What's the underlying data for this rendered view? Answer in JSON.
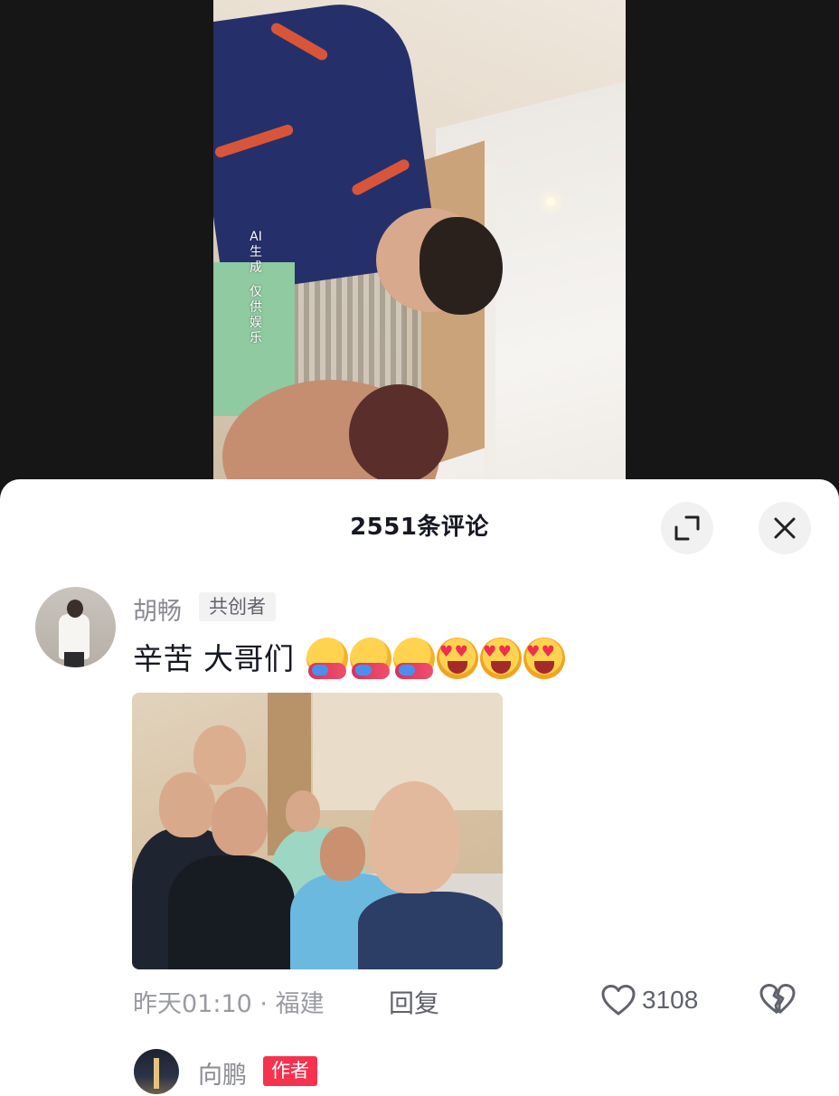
{
  "video": {
    "ai_label_lines": [
      "AI",
      "生成",
      "",
      "仅供",
      "娱乐"
    ]
  },
  "comments_panel": {
    "title": "2551条评论",
    "expand_icon": "expand-icon",
    "close_icon": "close-icon"
  },
  "comments": [
    {
      "username": "胡畅",
      "tag": "共创者",
      "text": "辛苦 大哥们",
      "emojis": [
        "hug-emoji",
        "hug-emoji",
        "hug-emoji",
        "heart-eyes-emoji",
        "heart-eyes-emoji",
        "heart-eyes-emoji"
      ],
      "has_photo": true,
      "time": "昨天01:10",
      "separator": "·",
      "location": "福建",
      "reply_label": "回复",
      "like_count": "3108"
    },
    {
      "username": "向鹏",
      "tag": "作者"
    }
  ],
  "colors": {
    "author_tag": "#f5334f",
    "sheet_bg": "#ffffff",
    "backdrop": "#161616"
  }
}
